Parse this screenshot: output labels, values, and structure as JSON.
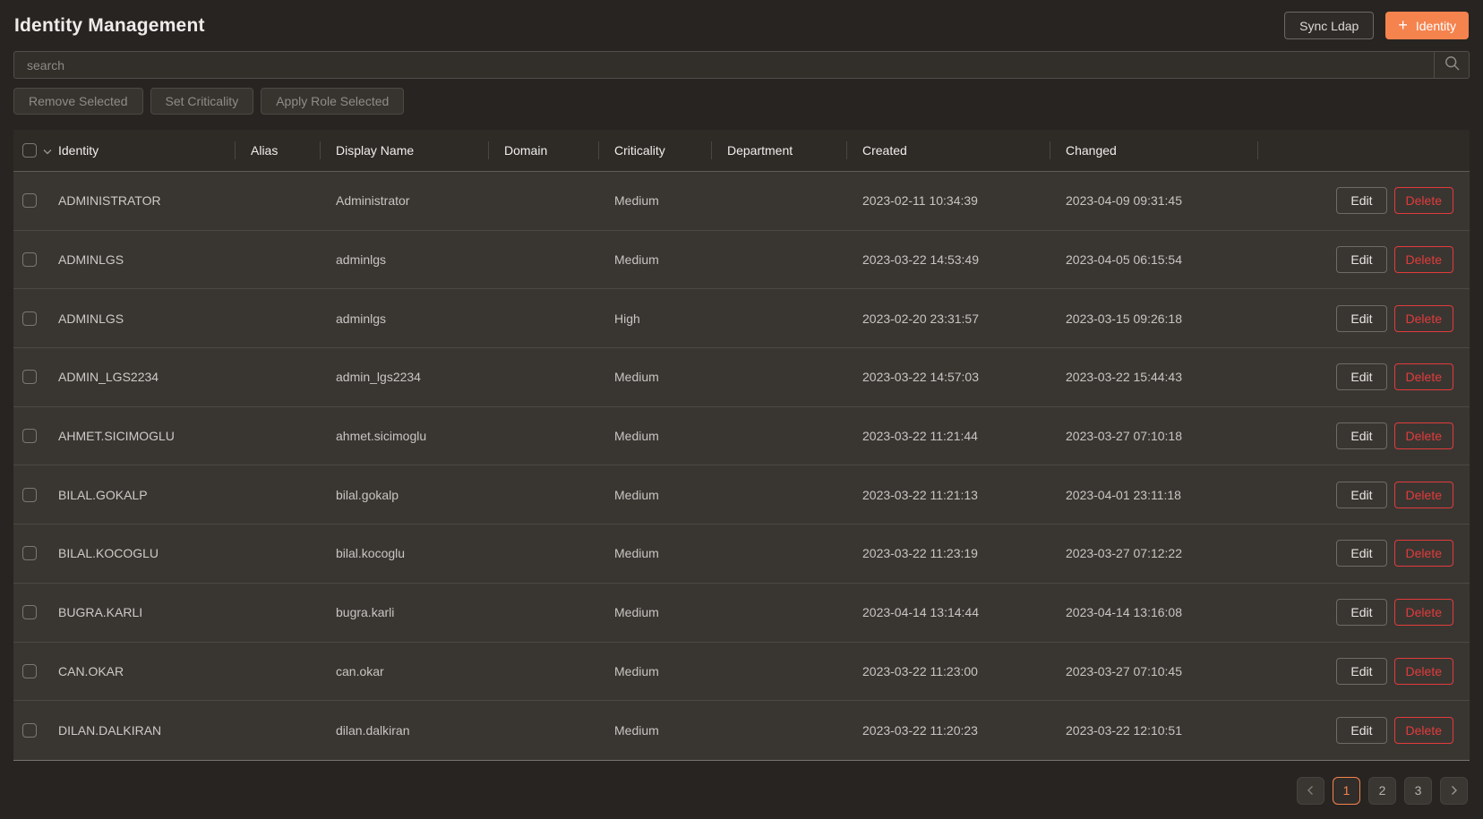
{
  "page": {
    "title": "Identity Management"
  },
  "header": {
    "sync_ldap_label": "Sync Ldap",
    "plus_icon": "+",
    "add_identity_label": "Identity"
  },
  "search": {
    "placeholder": "search"
  },
  "bulk_actions": [
    {
      "label": "Remove Selected"
    },
    {
      "label": "Set Criticality"
    },
    {
      "label": "Apply Role Selected"
    }
  ],
  "table": {
    "columns": [
      "Identity",
      "Alias",
      "Display Name",
      "Domain",
      "Criticality",
      "Department",
      "Created",
      "Changed"
    ],
    "row_actions": {
      "edit_label": "Edit",
      "delete_label": "Delete"
    },
    "rows": [
      {
        "identity": "ADMINISTRATOR",
        "alias": "",
        "display_name": "Administrator",
        "domain": "",
        "criticality": "Medium",
        "department": "",
        "created": "2023-02-11 10:34:39",
        "changed": "2023-04-09 09:31:45"
      },
      {
        "identity": "ADMINLGS",
        "alias": "",
        "display_name": "adminlgs",
        "domain": "",
        "criticality": "Medium",
        "department": "",
        "created": "2023-03-22 14:53:49",
        "changed": "2023-04-05 06:15:54"
      },
      {
        "identity": "ADMINLGS",
        "alias": "",
        "display_name": "adminlgs",
        "domain": "",
        "criticality": "High",
        "department": "",
        "created": "2023-02-20 23:31:57",
        "changed": "2023-03-15 09:26:18"
      },
      {
        "identity": "ADMIN_LGS2234",
        "alias": "",
        "display_name": "admin_lgs2234",
        "domain": "",
        "criticality": "Medium",
        "department": "",
        "created": "2023-03-22 14:57:03",
        "changed": "2023-03-22 15:44:43"
      },
      {
        "identity": "AHMET.SICIMOGLU",
        "alias": "",
        "display_name": "ahmet.sicimoglu",
        "domain": "",
        "criticality": "Medium",
        "department": "",
        "created": "2023-03-22 11:21:44",
        "changed": "2023-03-27 07:10:18"
      },
      {
        "identity": "BILAL.GOKALP",
        "alias": "",
        "display_name": "bilal.gokalp",
        "domain": "",
        "criticality": "Medium",
        "department": "",
        "created": "2023-03-22 11:21:13",
        "changed": "2023-04-01 23:11:18"
      },
      {
        "identity": "BILAL.KOCOGLU",
        "alias": "",
        "display_name": "bilal.kocoglu",
        "domain": "",
        "criticality": "Medium",
        "department": "",
        "created": "2023-03-22 11:23:19",
        "changed": "2023-03-27 07:12:22"
      },
      {
        "identity": "BUGRA.KARLI",
        "alias": "",
        "display_name": "bugra.karli",
        "domain": "",
        "criticality": "Medium",
        "department": "",
        "created": "2023-04-14 13:14:44",
        "changed": "2023-04-14 13:16:08"
      },
      {
        "identity": "CAN.OKAR",
        "alias": "",
        "display_name": "can.okar",
        "domain": "",
        "criticality": "Medium",
        "department": "",
        "created": "2023-03-22 11:23:00",
        "changed": "2023-03-27 07:10:45"
      },
      {
        "identity": "DILAN.DALKIRAN",
        "alias": "",
        "display_name": "dilan.dalkiran",
        "domain": "",
        "criticality": "Medium",
        "department": "",
        "created": "2023-03-22 11:20:23",
        "changed": "2023-03-22 12:10:51"
      }
    ]
  },
  "pagination": {
    "pages": [
      "1",
      "2",
      "3"
    ],
    "active_page": "1"
  },
  "colors": {
    "accent_orange": "#f5834e",
    "danger_red": "#e23b3b",
    "background": "#282421",
    "row_background": "#393632"
  }
}
